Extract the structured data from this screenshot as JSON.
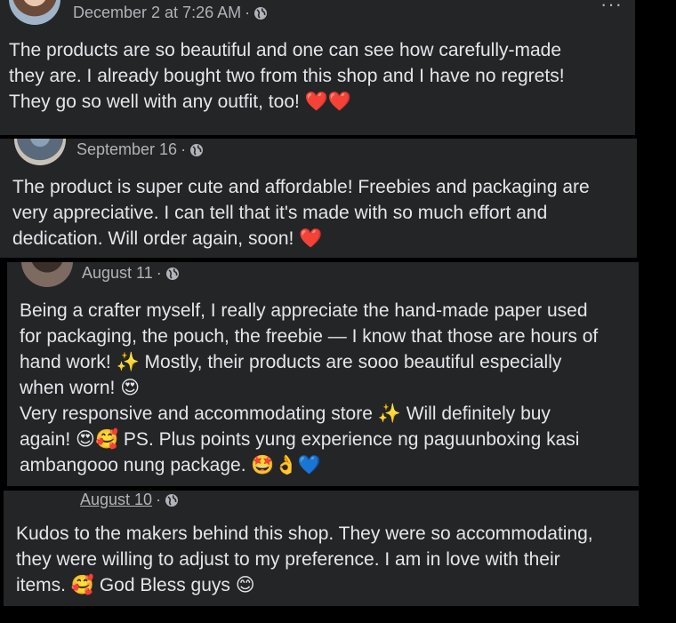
{
  "comments": [
    {
      "timestamp": "December 2 at 7:26 AM",
      "separator": "·",
      "lines": [
        "The products are so beautiful and one can see how carefully-made",
        "they are. I already bought two from this shop and I have no regrets!",
        "They go so well with any outfit, too! ❤️❤️"
      ]
    },
    {
      "timestamp": "September 16",
      "separator": "·",
      "lines": [
        "The product is super cute and affordable! Freebies and packaging are",
        "very appreciative. I can tell that it's made with so much effort and",
        "dedication. Will order again, soon! ❤️"
      ]
    },
    {
      "timestamp": "August 11",
      "separator": "·",
      "lines": [
        "Being a crafter myself, I really appreciate the hand-made paper used",
        "for packaging, the pouch, the freebie — I know that those are hours of",
        "hand work! ✨ Mostly, their products are sooo beautiful especially",
        "when worn! 😍",
        "Very responsive and accommodating store ✨  Will definitely buy",
        "again! 😍🥰 PS. Plus points yung experience ng paguunboxing kasi",
        "ambangooo nung package. 🤩👌💙"
      ]
    },
    {
      "timestamp": "August 10",
      "separator": "·",
      "lines": [
        "Kudos to the makers behind this shop. They were so accommodating,",
        "they were willing to adjust to my preference. I am in love with their",
        "items. 🥰 God Bless guys 😊"
      ]
    }
  ],
  "icons": {
    "privacy": "globe-icon",
    "more": "more-options-icon"
  },
  "colors": {
    "card_bg": "#242526",
    "page_bg": "#000000",
    "text": "#e4e6eb",
    "meta": "#b0b3b8"
  }
}
